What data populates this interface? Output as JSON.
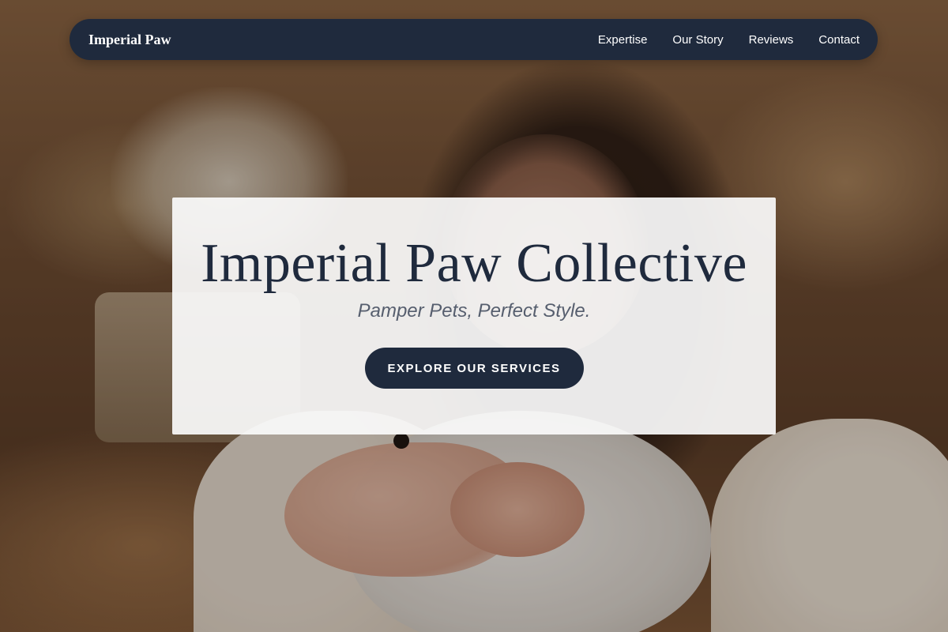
{
  "nav": {
    "brand": "Imperial Paw",
    "links": [
      {
        "label": "Expertise"
      },
      {
        "label": "Our Story"
      },
      {
        "label": "Reviews"
      },
      {
        "label": "Contact"
      }
    ]
  },
  "hero": {
    "title": "Imperial Paw Collective",
    "tagline": "Pamper Pets, Perfect Style.",
    "cta_label": "EXPLORE OUR SERVICES",
    "background_image": "woman-holding-white-bunny-photo"
  },
  "colors": {
    "navy": "#1f2a3d",
    "card": "#fafafa",
    "tagline": "#565e6e",
    "text_light": "#ffffff"
  }
}
